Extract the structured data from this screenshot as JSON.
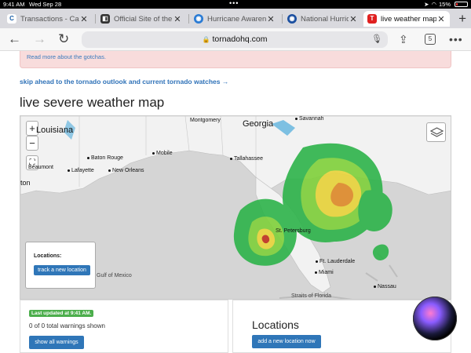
{
  "status_bar": {
    "time": "9:41 AM",
    "date": "Wed Sep 28",
    "battery": "15%"
  },
  "tabs": [
    {
      "title": "Transactions - Cap",
      "icon": "capital-one-icon",
      "color": "#1a5fa8"
    },
    {
      "title": "Official Site of the",
      "icon": "site-icon",
      "color": "#333333"
    },
    {
      "title": "Hurricane Awarene",
      "icon": "nws-icon",
      "color": "#2a7bd4"
    },
    {
      "title": "National Hurricane",
      "icon": "noaa-icon",
      "color": "#1b4fa0"
    },
    {
      "title": "live weather map |",
      "icon": "tornado-hq-icon",
      "color": "#e02020"
    }
  ],
  "toolbar": {
    "url": "tornadohq.com",
    "tab_count": "5"
  },
  "page": {
    "alert_link": "Read more about the gotchas.",
    "skip_link": "skip ahead to the tornado outlook and current tornado watches →",
    "map_heading": "live severe weather map",
    "map": {
      "zoom_in": "+",
      "zoom_out": "−",
      "locations_label": "Locations:",
      "track_button": "track a new location",
      "labels": {
        "louisiana": "Louisiana",
        "georgia": "Georgia",
        "montgomery": "Montgomery",
        "savannah": "Savannah",
        "baton_rouge": "Baton Rouge",
        "lafayette": "Lafayette",
        "new_orleans": "New Orleans",
        "mobile": "Mobile",
        "tallahassee": "Tallahassee",
        "gulf": "Gulf of Mexico",
        "st_petersburg": "St. Petersburg",
        "fort_lauderdale": "Ft. Lauderdale",
        "miami": "Miami",
        "nassau": "Nassau",
        "straits": "Straits of Florida",
        "beaumont": "Beaumont",
        "houston_partial": "ton"
      }
    },
    "updated_badge": "Last updated at 9:41 AM.",
    "warnings_text": "0 of 0 total warnings shown",
    "show_warnings_button": "show all warnings",
    "locations_title": "Locations",
    "add_location_button": "add a new location now"
  }
}
